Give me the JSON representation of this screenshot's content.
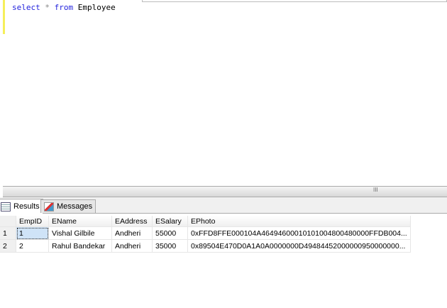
{
  "editor": {
    "query": {
      "kw1": "select",
      "star": "*",
      "kw2": "from",
      "table": "Employee"
    }
  },
  "tabs": [
    {
      "label": "Results",
      "icon": "grid-icon"
    },
    {
      "label": "Messages",
      "icon": "messages-icon"
    }
  ],
  "grid": {
    "columns": [
      "EmpID",
      "EName",
      "EAddress",
      "ESalary",
      "EPhoto"
    ],
    "rows": [
      {
        "num": "1",
        "cells": [
          "1",
          "Vishal Gilbile",
          "Andheri",
          "55000",
          "0xFFD8FFE000104A46494600010101004800480000FFDB004..."
        ]
      },
      {
        "num": "2",
        "cells": [
          "2",
          "Rahul Bandekar",
          "Andheri",
          "35000",
          "0x89504E470D0A1A0A0000000D49484452000000950000000..."
        ]
      }
    ]
  },
  "scrollbar": {
    "grip": "III"
  }
}
